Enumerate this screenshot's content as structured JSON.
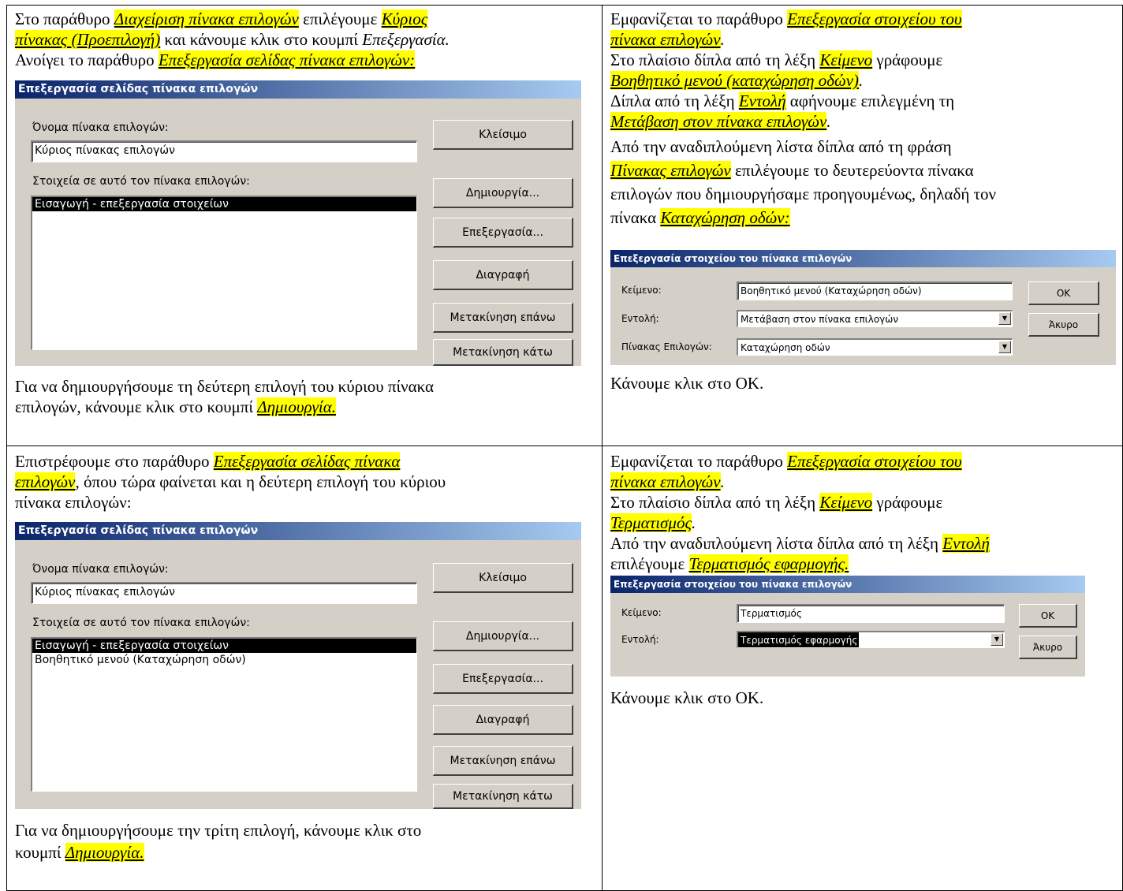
{
  "cell1": {
    "p1_a": "Στο παράθυρο ",
    "p1_hl1": "Διαχείριση πίνακα επιλογών",
    "p1_b": " επιλέγουμε ",
    "p1_hl2a": "Κύριος",
    "p1_hl2b": "πίνακας (Προεπιλογή)",
    "p1_c": " και κάνουμε κλικ στο κουμπί ",
    "p1_it": "Επεξεργασία.",
    "p2_a": "Ανοίγει το παράθυρο ",
    "p2_hl": "Επεξεργασία σελίδας πίνακα επιλογών:",
    "after_1": "Για να δημιουργήσουμε τη δεύτερη επιλογή του κύριου πίνακα",
    "after_2a": "επιλογών, κάνουμε κλικ στο κουμπί ",
    "after_2hl": "Δημιουργία."
  },
  "dialog_switchboard_page": {
    "title": "Επεξεργασία σελίδας πίνακα επιλογών",
    "name_label": "Όνομα πίνακα επιλογών:",
    "name_value": "Κύριος πίνακας επιλογών",
    "items_label": "Στοιχεία σε αυτό τον πίνακα επιλογών:",
    "btn_close": "Κλείσιμο",
    "btn_new": "Δημιουργία...",
    "btn_edit": "Επεξεργασία...",
    "btn_delete": "Διαγραφή",
    "btn_move_up": "Μετακίνηση επάνω",
    "btn_move_down": "Μετακίνηση κάτω",
    "items_first": [
      "Εισαγωγή - επεξεργασία στοιχείων"
    ],
    "items_second": [
      "Εισαγωγή - επεξεργασία στοιχείων",
      "Βοηθητικό μενού (Καταχώρηση οδών)"
    ]
  },
  "cell2": {
    "l1_a": "Εμφανίζεται το παράθυρο ",
    "l1_hl": "Επεξεργασία στοιχείου του",
    "l2_hl": "πίνακα επιλογών",
    "l2_b": ".",
    "l3_a": "Στο πλαίσιο δίπλα από τη λέξη ",
    "l3_hl": "Κείμενο",
    "l3_b": " γράφουμε",
    "l4_hl": "Βοηθητικό μενού (καταχώρηση οδών)",
    "l4_b": ".",
    "l5_a": "Δίπλα από τη λέξη ",
    "l5_hl": "Εντολή",
    "l5_b": " αφήνουμε επιλεγμένη τη",
    "l6_hl": "Μετάβαση στον πίνακα επιλογών",
    "l6_b": ".",
    "l7": "Από την αναδιπλούμενη λίστα δίπλα από τη φράση",
    "l8_hl": "Πίνακας επιλογών",
    "l8_b": " επιλέγουμε το δευτερεύοντα πίνακα",
    "l9": "επιλογών που δημιουργήσαμε προηγουμένως, δηλαδή τον",
    "l10_a": "πίνακα ",
    "l10_hl": "Καταχώρηση οδών:",
    "after": "Κάνουμε κλικ στο OK."
  },
  "dialog_item_1": {
    "title": "Επεξεργασία στοιχείου του πίνακα επιλογών",
    "text_label": "Κείμενο:",
    "text_value": "Βοηθητικό μενού (Καταχώρηση οδών)",
    "command_label": "Εντολή:",
    "command_value": "Μετάβαση στον πίνακα επιλογών",
    "switchboard_label": "Πίνακας Επιλογών:",
    "switchboard_value": "Καταχώρηση οδών",
    "btn_ok": "OK",
    "btn_cancel": "Άκυρο"
  },
  "cell3": {
    "l1_a": "Επιστρέφουμε στο παράθυρο ",
    "l1_hl": "Επεξεργασία σελίδας πίνακα",
    "l2_hl": "επιλογών",
    "l2_b": ", όπου τώρα φαίνεται και η δεύτερη επιλογή του κύριου",
    "l3": "πίνακα επιλογών:",
    "after_1": "Για να δημιουργήσουμε την τρίτη επιλογή, κάνουμε κλικ στο",
    "after_2a": "κουμπί ",
    "after_2hl": "Δημιουργία."
  },
  "cell4": {
    "l1_a": "Εμφανίζεται το παράθυρο ",
    "l1_hl": "Επεξεργασία στοιχείου του",
    "l2_hl": "πίνακα επιλογών",
    "l2_b": ".",
    "l3_a": "Στο πλαίσιο δίπλα από τη λέξη ",
    "l3_hl": "Κείμενο",
    "l3_b": " γράφουμε",
    "l4_hl": "Τερματισμός",
    "l4_b": ".",
    "l5_a": "Από την αναδιπλούμενη λίστα δίπλα από τη λέξη ",
    "l5_hl": "Εντολή",
    "l6_a": "επιλέγουμε ",
    "l6_hl": "Τερματισμός εφαρμογής.",
    "after": "Κάνουμε κλικ στο OK."
  },
  "dialog_item_2": {
    "title": "Επεξεργασία στοιχείου του πίνακα επιλογών",
    "text_label": "Κείμενο:",
    "text_value": "Τερματισμός",
    "command_label": "Εντολή:",
    "command_value": "Τερματισμός εφαρμογής",
    "btn_ok": "OK",
    "btn_cancel": "Άκυρο"
  }
}
